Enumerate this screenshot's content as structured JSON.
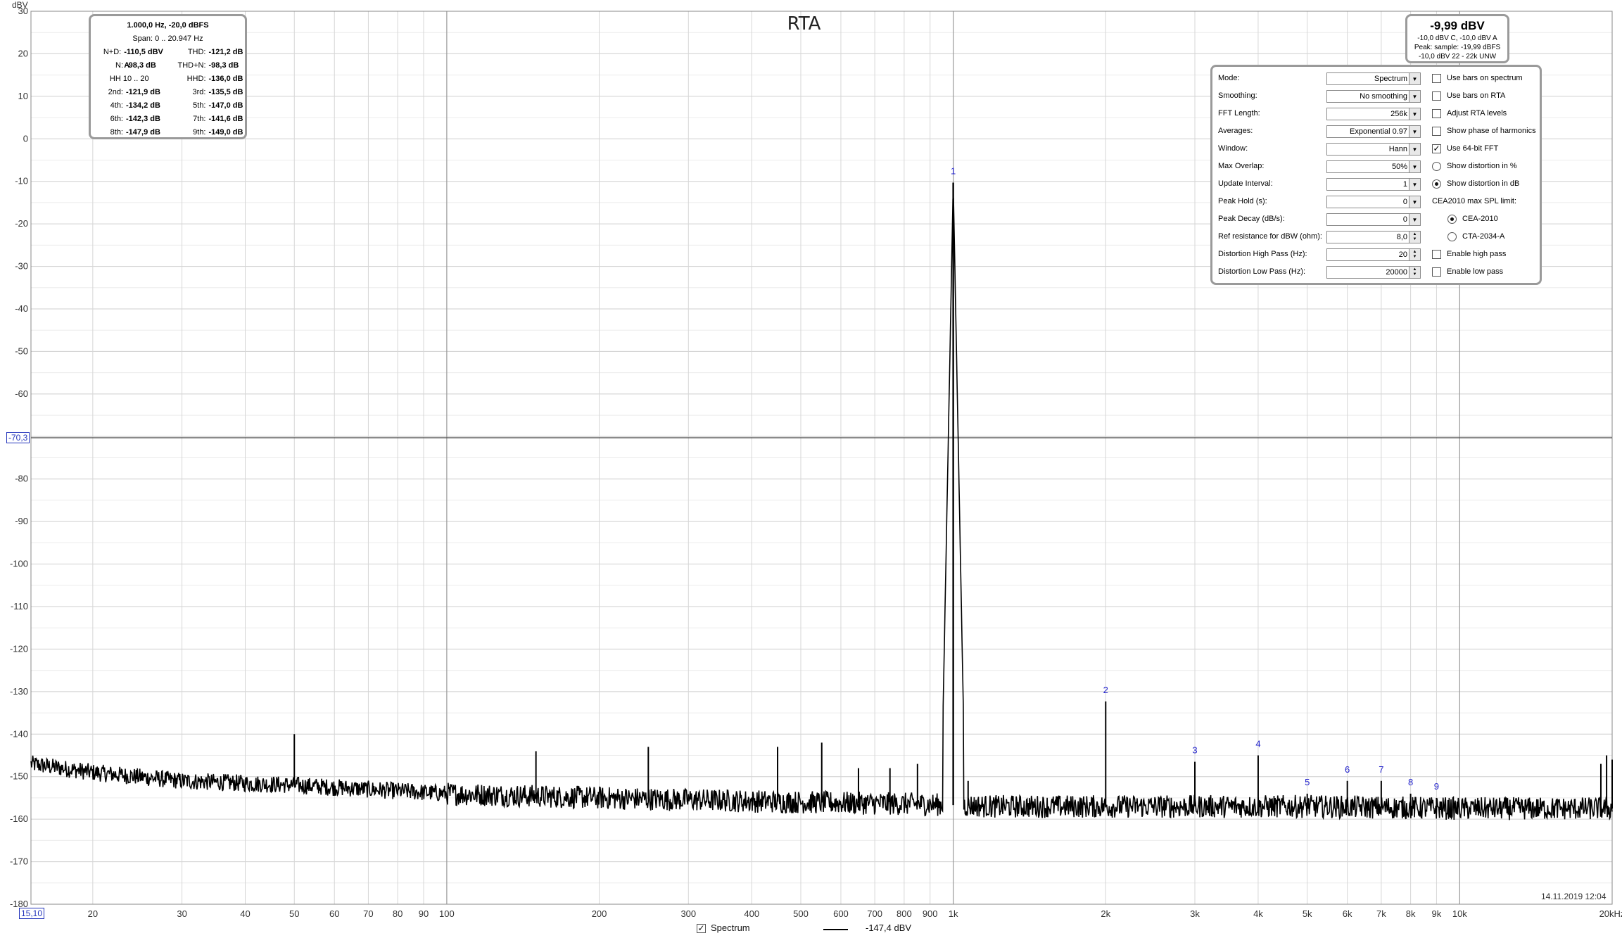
{
  "chart_data": {
    "type": "line",
    "title": "RTA",
    "ylabel": "dBV",
    "x_scale": "log",
    "xlim": [
      15.1,
      20000
    ],
    "ylim": [
      -180,
      30
    ],
    "grid": true,
    "y_ticks": [
      "30",
      "20",
      "10",
      "0",
      "-10",
      "-20",
      "-30",
      "-40",
      "-50",
      "-60",
      "-70",
      "-80",
      "-90",
      "-100",
      "-110",
      "-120",
      "-130",
      "-140",
      "-150",
      "-160",
      "-170",
      "-180"
    ],
    "x_ticks": [
      {
        "v": 20,
        "l": "20"
      },
      {
        "v": 30,
        "l": "30"
      },
      {
        "v": 40,
        "l": "40"
      },
      {
        "v": 50,
        "l": "50"
      },
      {
        "v": 60,
        "l": "60"
      },
      {
        "v": 70,
        "l": "70"
      },
      {
        "v": 80,
        "l": "80"
      },
      {
        "v": 90,
        "l": "90"
      },
      {
        "v": 100,
        "l": "100"
      },
      {
        "v": 200,
        "l": "200"
      },
      {
        "v": 300,
        "l": "300"
      },
      {
        "v": 400,
        "l": "400"
      },
      {
        "v": 500,
        "l": "500"
      },
      {
        "v": 600,
        "l": "600"
      },
      {
        "v": 700,
        "l": "700"
      },
      {
        "v": 800,
        "l": "800"
      },
      {
        "v": 900,
        "l": "900"
      },
      {
        "v": 1000,
        "l": "1k"
      },
      {
        "v": 2000,
        "l": "2k"
      },
      {
        "v": 3000,
        "l": "3k"
      },
      {
        "v": 4000,
        "l": "4k"
      },
      {
        "v": 5000,
        "l": "5k"
      },
      {
        "v": 6000,
        "l": "6k"
      },
      {
        "v": 7000,
        "l": "7k"
      },
      {
        "v": 8000,
        "l": "8k"
      },
      {
        "v": 9000,
        "l": "9k"
      },
      {
        "v": 10000,
        "l": "10k"
      },
      {
        "v": 20000,
        "l": "20kHz"
      }
    ],
    "cursor_y": -70.3,
    "series": [
      {
        "name": "Spectrum",
        "color": "#000000",
        "floor_points": [
          [
            15.1,
            -147
          ],
          [
            20,
            -149
          ],
          [
            30,
            -151
          ],
          [
            50,
            -152
          ],
          [
            100,
            -154
          ],
          [
            200,
            -155
          ],
          [
            500,
            -156
          ],
          [
            900,
            -156.5
          ],
          [
            1200,
            -157
          ],
          [
            2000,
            -157
          ],
          [
            5000,
            -157
          ],
          [
            10000,
            -157.5
          ],
          [
            20000,
            -157.5
          ]
        ],
        "noise_peak_to_peak_db": 4.5,
        "peaks": [
          [
            50,
            -140
          ],
          [
            150,
            -144
          ],
          [
            250,
            -143
          ],
          [
            450,
            -143
          ],
          [
            550,
            -142
          ],
          [
            650,
            -148
          ],
          [
            750,
            -148
          ],
          [
            850,
            -147
          ],
          [
            1000,
            -10.3
          ],
          [
            1070,
            -151
          ],
          [
            2000,
            -132.3
          ],
          [
            3000,
            -146.5
          ],
          [
            4000,
            -145
          ],
          [
            5000,
            -154
          ],
          [
            6000,
            -151
          ],
          [
            7000,
            -151
          ],
          [
            8000,
            -154
          ],
          [
            9000,
            -155
          ],
          [
            19000,
            -147
          ],
          [
            19500,
            -145
          ],
          [
            20000,
            -146
          ]
        ]
      }
    ],
    "harmonic_markers": [
      {
        "label": "1",
        "f": 1000,
        "db": -10.3
      },
      {
        "label": "2",
        "f": 2000,
        "db": -132.3
      },
      {
        "label": "3",
        "f": 3000,
        "db": -146.5
      },
      {
        "label": "4",
        "f": 4000,
        "db": -145
      },
      {
        "label": "5",
        "f": 5000,
        "db": -154
      },
      {
        "label": "6",
        "f": 6000,
        "db": -151
      },
      {
        "label": "7",
        "f": 7000,
        "db": -151
      },
      {
        "label": "8",
        "f": 8000,
        "db": -154
      },
      {
        "label": "9",
        "f": 9000,
        "db": -155
      }
    ]
  },
  "axis": {
    "y_unit": "dBV",
    "cursor_y_label": "-70,3",
    "cursor_x_label": "15,10"
  },
  "distortion_panel": {
    "header": "1.000,0 Hz, -20,0 dBFS",
    "span": "Span: 0 .. 20.947 Hz",
    "rows": [
      [
        {
          "label": "N+D:",
          "value": "-110,5 dBV A"
        },
        {
          "label": "THD:",
          "value": "-121,2 dB"
        }
      ],
      [
        {
          "label": "N:",
          "value": "-98,3 dB"
        },
        {
          "label": "THD+N:",
          "value": "-98,3 dB"
        }
      ],
      [
        {
          "label": "HH 10 .. 20",
          "value": ""
        },
        {
          "label": "HHD:",
          "value": "-136,0 dB"
        }
      ],
      [
        {
          "label": "2nd:",
          "value": "-121,9 dB"
        },
        {
          "label": "3rd:",
          "value": "-135,5 dB"
        }
      ],
      [
        {
          "label": "4th:",
          "value": "-134,2 dB"
        },
        {
          "label": "5th:",
          "value": "-147,0 dB"
        }
      ],
      [
        {
          "label": "6th:",
          "value": "-142,3 dB"
        },
        {
          "label": "7th:",
          "value": "-141,6 dB"
        }
      ],
      [
        {
          "label": "8th:",
          "value": "-147,9 dB"
        },
        {
          "label": "9th:",
          "value": "-149,0 dB"
        }
      ]
    ]
  },
  "level_panel": {
    "main": "-9,99 dBV",
    "line1": "-10,0 dBV C, -10,0 dBV A",
    "line2": "Peak: sample: -19,99 dBFS",
    "line3": "-10,0 dBV 22 - 22k UNW"
  },
  "settings": {
    "mode": {
      "label": "Mode:",
      "value": "Spectrum"
    },
    "smoothing": {
      "label": "Smoothing:",
      "value": "No  smoothing"
    },
    "fft_length": {
      "label": "FFT Length:",
      "value": "256k"
    },
    "averages": {
      "label": "Averages:",
      "value": "Exponential 0.97"
    },
    "window": {
      "label": "Window:",
      "value": "Hann"
    },
    "max_overlap": {
      "label": "Max Overlap:",
      "value": "50%"
    },
    "update_interval": {
      "label": "Update Interval:",
      "value": "1"
    },
    "peak_hold": {
      "label": "Peak Hold (s):",
      "value": "0"
    },
    "peak_decay": {
      "label": "Peak Decay (dB/s):",
      "value": "0"
    },
    "ref_resistance": {
      "label": "Ref resistance for dBW (ohm):",
      "value": "8,0"
    },
    "dist_high_pass": {
      "label": "Distortion High Pass (Hz):",
      "value": "20"
    },
    "dist_low_pass": {
      "label": "Distortion Low Pass (Hz):",
      "value": "20000"
    },
    "use_bars_spectrum": {
      "label": "Use bars on spectrum",
      "checked": false
    },
    "use_bars_rta": {
      "label": "Use bars on RTA",
      "checked": false
    },
    "adjust_rta": {
      "label": "Adjust RTA levels",
      "checked": false
    },
    "show_phase": {
      "label": "Show phase of harmonics",
      "checked": false
    },
    "use_64bit": {
      "label": "Use 64-bit FFT",
      "checked": true
    },
    "show_dist_pct": {
      "label": "Show distortion in %",
      "selected": false
    },
    "show_dist_db": {
      "label": "Show distortion in dB",
      "selected": true
    },
    "cea_heading": "CEA2010 max SPL limit:",
    "cea_2010": {
      "label": "CEA-2010",
      "selected": true
    },
    "cta_2034": {
      "label": "CTA-2034-A",
      "selected": false
    },
    "enable_high_pass": {
      "label": "Enable high pass",
      "checked": false
    },
    "enable_low_pass": {
      "label": "Enable low pass",
      "checked": false
    }
  },
  "footer": {
    "timestamp": "14.11.2019 12:04",
    "legend_name": "Spectrum",
    "legend_checked": "✓",
    "legend_value": "-147,4 dBV"
  }
}
